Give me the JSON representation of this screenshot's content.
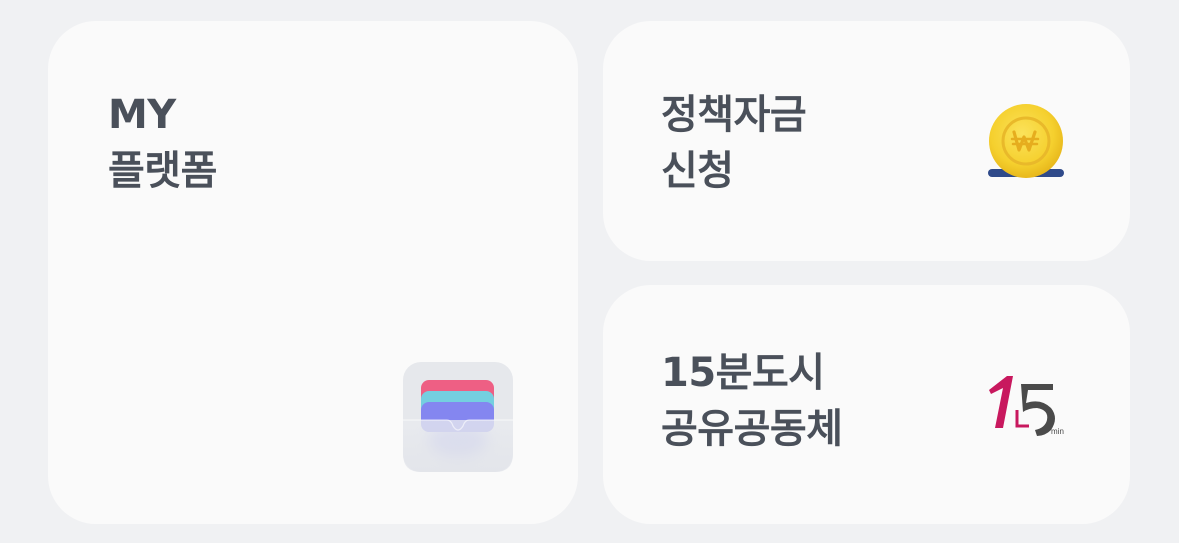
{
  "cards": {
    "my_platform": {
      "title_line1": "MY",
      "title_line2": "플랫폼",
      "icon": "wallet-icon"
    },
    "policy_fund": {
      "title_line1": "정책자금",
      "title_line2": "신청",
      "icon": "won-coin-icon"
    },
    "fifteen_min_city": {
      "title_line1": "15분도시",
      "title_line2": "공유공동체",
      "icon": "15min-logo-icon",
      "logo_text": "min"
    }
  },
  "colors": {
    "background": "#f0f1f3",
    "card": "#fafafa",
    "title": "#4a505a",
    "coin": "#f5d02e",
    "coin_base": "#2f4a8a",
    "logo_magenta": "#c8185e",
    "logo_dark": "#4a4a4a"
  }
}
